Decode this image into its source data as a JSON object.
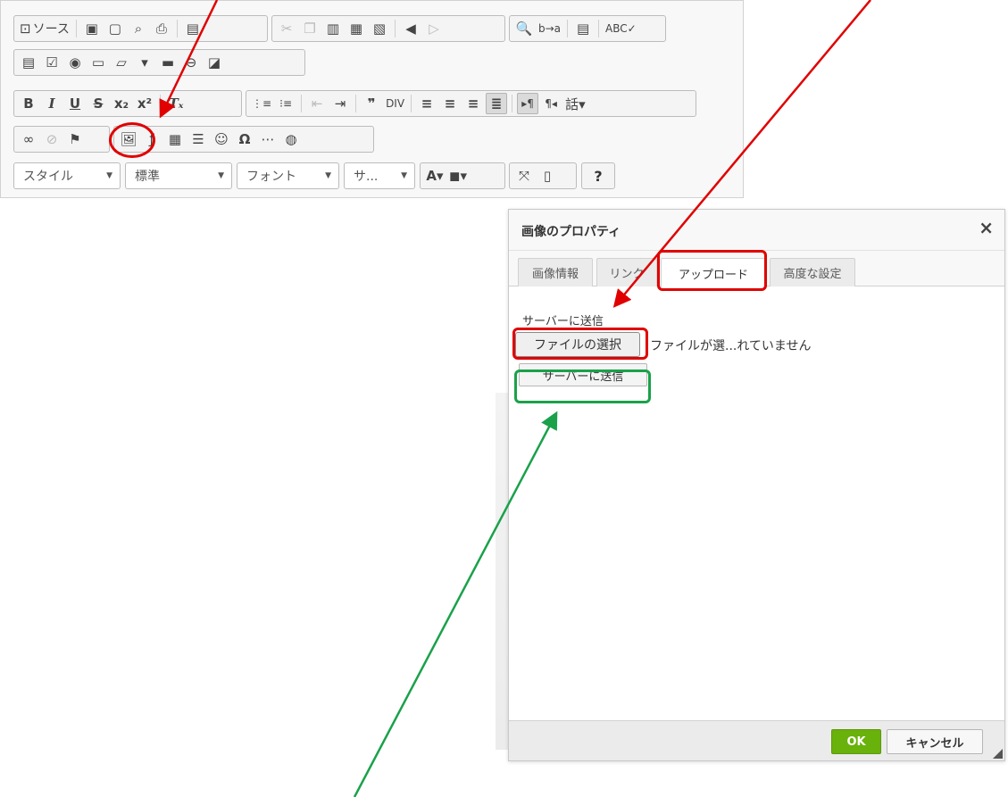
{
  "toolbar": {
    "source_label": "ソース",
    "row1": [
      {
        "icon": "source-icon",
        "glyph": "⊡"
      },
      {
        "icon": "save-icon",
        "glyph": "▣"
      },
      {
        "icon": "new-page-icon",
        "glyph": "▢"
      },
      {
        "icon": "preview-icon",
        "glyph": "⌕"
      },
      {
        "icon": "print-icon",
        "glyph": "⎙"
      },
      {
        "icon": "templates-icon",
        "glyph": "▤"
      },
      {
        "icon": "cut-icon",
        "glyph": "✂"
      },
      {
        "icon": "copy-icon",
        "glyph": "❐"
      },
      {
        "icon": "paste-icon",
        "glyph": "▥"
      },
      {
        "icon": "paste-text-icon",
        "glyph": "▦"
      },
      {
        "icon": "paste-word-icon",
        "glyph": "▧"
      },
      {
        "icon": "undo-icon",
        "glyph": "◀"
      },
      {
        "icon": "redo-icon",
        "glyph": "▷"
      },
      {
        "icon": "find-icon",
        "glyph": "🔍"
      },
      {
        "icon": "replace-icon",
        "glyph": "b→a"
      },
      {
        "icon": "select-all-icon",
        "glyph": "▤"
      },
      {
        "icon": "spellcheck-icon",
        "glyph": "ABC✓"
      }
    ],
    "row2": [
      {
        "icon": "form-icon",
        "glyph": "▤"
      },
      {
        "icon": "checkbox-icon",
        "glyph": "☑"
      },
      {
        "icon": "radio-icon",
        "glyph": "◉"
      },
      {
        "icon": "textfield-icon",
        "glyph": "▭"
      },
      {
        "icon": "textarea-icon",
        "glyph": "▱"
      },
      {
        "icon": "select-field-icon",
        "glyph": "▾"
      },
      {
        "icon": "button-field-icon",
        "glyph": "▬"
      },
      {
        "icon": "image-button-icon",
        "glyph": "⊖"
      },
      {
        "icon": "hidden-field-icon",
        "glyph": "◪"
      }
    ],
    "row3": [
      {
        "icon": "bold-icon",
        "glyph": "B"
      },
      {
        "icon": "italic-icon",
        "glyph": "I"
      },
      {
        "icon": "underline-icon",
        "glyph": "U"
      },
      {
        "icon": "strike-icon",
        "glyph": "S"
      },
      {
        "icon": "subscript-icon",
        "glyph": "x₂"
      },
      {
        "icon": "superscript-icon",
        "glyph": "x²"
      },
      {
        "icon": "remove-format-icon",
        "glyph": "Tₓ"
      },
      {
        "icon": "numbered-list-icon",
        "glyph": "⋮≡"
      },
      {
        "icon": "bullet-list-icon",
        "glyph": "⁝≡"
      },
      {
        "icon": "outdent-icon",
        "glyph": "⇤"
      },
      {
        "icon": "indent-icon",
        "glyph": "⇥"
      },
      {
        "icon": "blockquote-icon",
        "glyph": "❞"
      },
      {
        "icon": "div-icon",
        "glyph": "DIV"
      },
      {
        "icon": "align-left-icon",
        "glyph": "≡"
      },
      {
        "icon": "align-center-icon",
        "glyph": "≡"
      },
      {
        "icon": "align-right-icon",
        "glyph": "≡"
      },
      {
        "icon": "align-justify-icon",
        "glyph": "≣"
      },
      {
        "icon": "ltr-icon",
        "glyph": "▸¶"
      },
      {
        "icon": "rtl-icon",
        "glyph": "¶◂"
      },
      {
        "icon": "language-icon",
        "glyph": "話▾"
      }
    ],
    "row4": [
      {
        "icon": "link-icon",
        "glyph": "∞"
      },
      {
        "icon": "unlink-icon",
        "glyph": "⊘"
      },
      {
        "icon": "anchor-flag-icon",
        "glyph": "⚑"
      },
      {
        "icon": "image-icon",
        "glyph": "🖼"
      },
      {
        "icon": "flash-icon",
        "glyph": "ƒ"
      },
      {
        "icon": "table-icon",
        "glyph": "▦"
      },
      {
        "icon": "horizontal-line-icon",
        "glyph": "☰"
      },
      {
        "icon": "smiley-icon",
        "glyph": "☺"
      },
      {
        "icon": "special-char-icon",
        "glyph": "Ω"
      },
      {
        "icon": "page-break-icon",
        "glyph": "⋯"
      },
      {
        "icon": "iframe-icon",
        "glyph": "◍"
      }
    ],
    "combos": {
      "styles": "スタイル",
      "format": "標準",
      "font": "フォント",
      "size": "サ..."
    },
    "row5_icons": [
      {
        "icon": "text-color-icon",
        "glyph": "A▾"
      },
      {
        "icon": "bg-color-icon",
        "glyph": "◼▾"
      },
      {
        "icon": "maximize-icon",
        "glyph": "⤧"
      },
      {
        "icon": "show-blocks-icon",
        "glyph": "▯"
      },
      {
        "icon": "help-icon",
        "glyph": "?"
      }
    ]
  },
  "dialog": {
    "title": "画像のプロパティ",
    "close_glyph": "×",
    "tabs": [
      "画像情報",
      "リンク",
      "アップロード",
      "高度な設定"
    ],
    "active_tab": "アップロード",
    "upload_label": "サーバーに送信",
    "file_button": "ファイルの選択",
    "file_status": "ファイルが選...れていません",
    "send_button": "サーバーに送信",
    "ok_button": "OK",
    "cancel_button": "キャンセル"
  },
  "colors": {
    "annotation_red": "#e00000",
    "annotation_green": "#1aa14a",
    "ok_green": "#69b10b"
  }
}
